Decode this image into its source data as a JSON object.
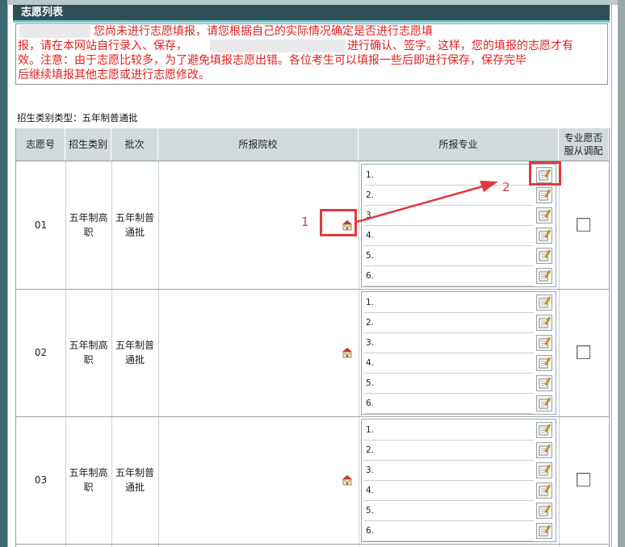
{
  "title": "志愿列表",
  "notice": {
    "line1": "您尚未进行志愿填报，请您根据自己的实际情况确定是否进行志愿填",
    "line2a": "报，请在本网站自行录入、保存，",
    "line2b": "进行确认、签字。这样，您的填报的志愿才有",
    "line3": "效。注意：由于志愿比较多，为了避免填报志愿出错。各位考生可以填报一些后即进行保存，保存完毕",
    "line4": "后继续填报其他志愿或进行志愿修改。"
  },
  "type_label": "招生类别类型：五年制普通批",
  "headers": {
    "index": "志愿号",
    "category": "招生类别",
    "batch": "批次",
    "school": "所报院校",
    "majors": "所报专业",
    "adjust_line1": "专业愿否",
    "adjust_line2": "服从调配"
  },
  "rows": [
    {
      "index": "01",
      "category_l1": "五年制高",
      "category_l2": "职",
      "batch_l1": "五年制普",
      "batch_l2": "通批",
      "majors": [
        "1.",
        "2.",
        "3.",
        "4.",
        "5.",
        "6."
      ]
    },
    {
      "index": "02",
      "category_l1": "五年制高",
      "category_l2": "职",
      "batch_l1": "五年制普",
      "batch_l2": "通批",
      "majors": [
        "1.",
        "2.",
        "3.",
        "4.",
        "5.",
        "6."
      ]
    },
    {
      "index": "03",
      "category_l1": "五年制高",
      "category_l2": "职",
      "batch_l1": "五年制普",
      "batch_l2": "通批",
      "majors": [
        "1.",
        "2.",
        "3.",
        "4.",
        "5.",
        "6."
      ]
    }
  ],
  "annotations": {
    "one": "1",
    "two": "2"
  },
  "colors": {
    "notice_text": "#e0201e",
    "annotation": "#e03a3e",
    "title_bar": "#2f4f57",
    "header_bg": "#d2dade"
  }
}
